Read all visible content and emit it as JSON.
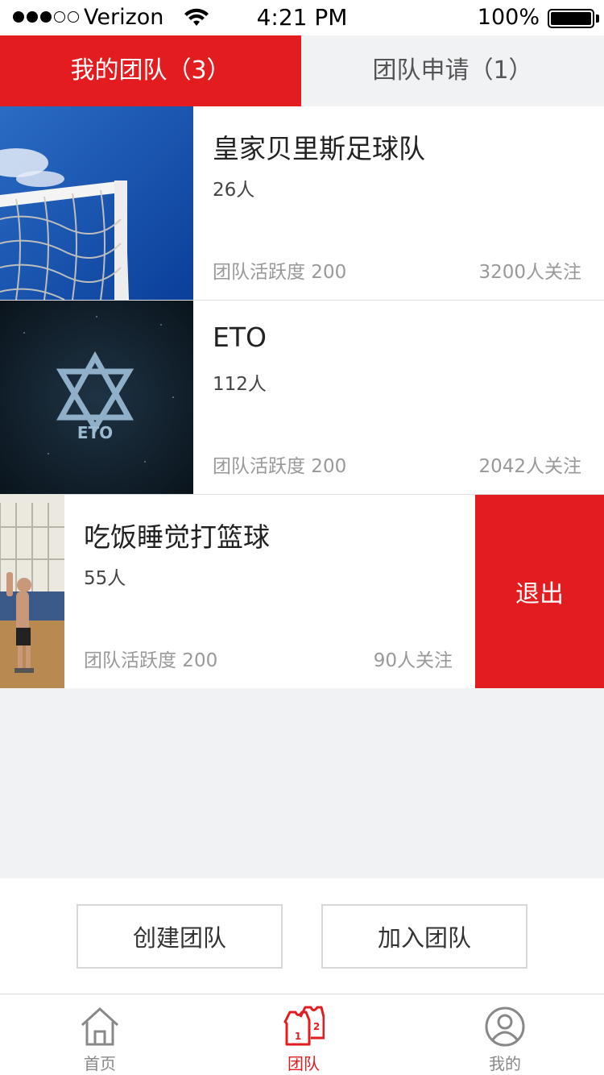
{
  "status_bar": {
    "carrier": "Verizon",
    "time": "4:21 PM",
    "battery": "100%"
  },
  "tabs": [
    {
      "label": "我的团队（3）",
      "active": true
    },
    {
      "label": "团队申请（1）",
      "active": false
    }
  ],
  "teams": [
    {
      "name": "皇家贝里斯足球队",
      "members": "26人",
      "activity": "团队活跃度 200",
      "followers": "3200人关注",
      "image_icon": "soccer-goal-photo"
    },
    {
      "name": "ETO",
      "members": "112人",
      "activity": "团队活跃度 200",
      "followers": "2042人关注",
      "image_icon": "eto-star-logo",
      "logo_text": "ETO"
    },
    {
      "name": "吃饭睡觉打篮球",
      "members": "55人",
      "activity": "团队活跃度 200",
      "followers": "90人关注",
      "image_icon": "basketball-player-photo",
      "swipe_action": "退出"
    }
  ],
  "actions": {
    "create_label": "创建团队",
    "join_label": "加入团队"
  },
  "nav": [
    {
      "label": "首页",
      "icon": "home-icon",
      "active": false
    },
    {
      "label": "团队",
      "icon": "team-jersey-icon",
      "active": true
    },
    {
      "label": "我的",
      "icon": "profile-icon",
      "active": false
    }
  ],
  "colors": {
    "accent": "#e31d1f",
    "background": "#f1f2f4"
  }
}
